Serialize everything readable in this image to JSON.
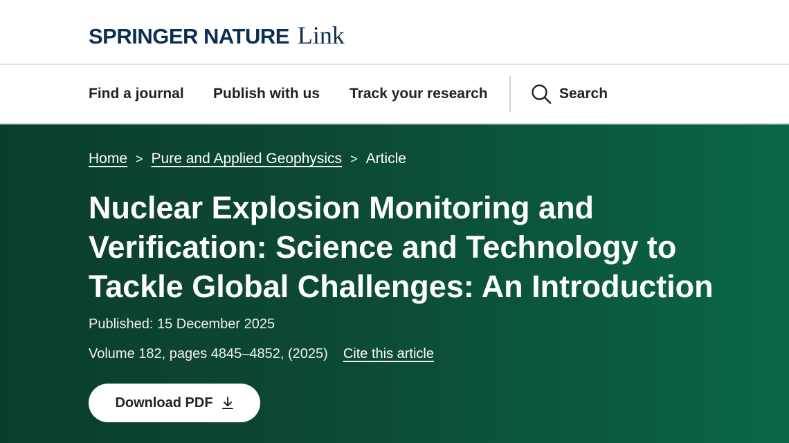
{
  "logo": {
    "brand": "SPRINGER NATURE",
    "product": "Link"
  },
  "nav": {
    "items": [
      {
        "label": "Find a journal"
      },
      {
        "label": "Publish with us"
      },
      {
        "label": "Track your research"
      }
    ],
    "search_label": "Search"
  },
  "breadcrumb": {
    "home": "Home",
    "journal": "Pure and Applied Geophysics",
    "current": "Article",
    "separator": ">"
  },
  "article": {
    "title_lines": [
      "Nuclear Explosion Monitoring and",
      "Verification: Science and Technology to",
      "Tackle Global Challenges: An Introduction"
    ],
    "published": "Published: 15 December 2025",
    "volume": "Volume 182, pages 4845–4852, (2025)",
    "cite_label": "Cite this article",
    "download_label": "Download PDF"
  },
  "colors": {
    "brand_navy": "#0b2f52",
    "hero_green_dark": "#0b3d2c",
    "hero_green_light": "#0a6647"
  },
  "icons": {
    "search": "search-icon",
    "download": "download-icon",
    "chevron": "chevron-right-icon"
  }
}
